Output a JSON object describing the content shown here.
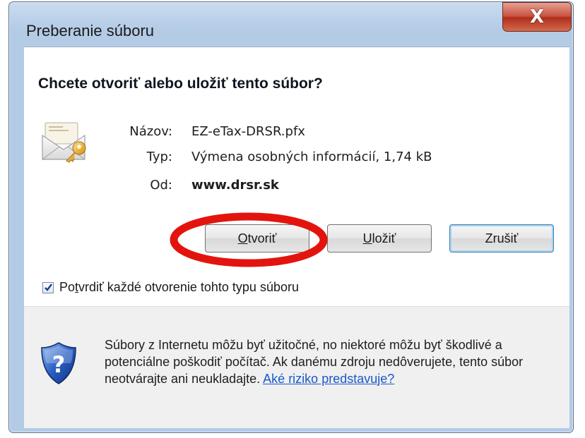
{
  "window": {
    "title": "Preberanie súboru",
    "close_symbol": "X",
    "close_icon": "close-icon"
  },
  "question": "Chcete otvoriť alebo uložiť tento súbor?",
  "file": {
    "icon": "certificate-envelope-icon",
    "name_label": "Názov:",
    "name_value": "EZ-eTax-DRSR.pfx",
    "type_label": "Typ:",
    "type_value": "Výmena osobných informácií, 1,74 kB",
    "from_label": "Od:",
    "from_value": "www.drsr.sk"
  },
  "buttons": {
    "open_first": "O",
    "open_rest": "tvoriť",
    "save_first": "U",
    "save_rest": "ložiť",
    "cancel": "Zrušiť"
  },
  "checkbox": {
    "checked": true,
    "label_pre": "Po",
    "label_access": "t",
    "label_post": "vrdiť každé otvorenie tohto typu súboru"
  },
  "warning": {
    "icon": "shield-question-icon",
    "text": "Súbory z Internetu môžu byť užitočné, no niektoré môžu byť škodlivé a potenciálne poškodiť počítač. Ak danému zdroju nedôverujete, tento súbor neotvárajte ani neukladajte. ",
    "link": "Aké riziko predstavuje?"
  },
  "annotation": {
    "color": "#e3140e"
  }
}
